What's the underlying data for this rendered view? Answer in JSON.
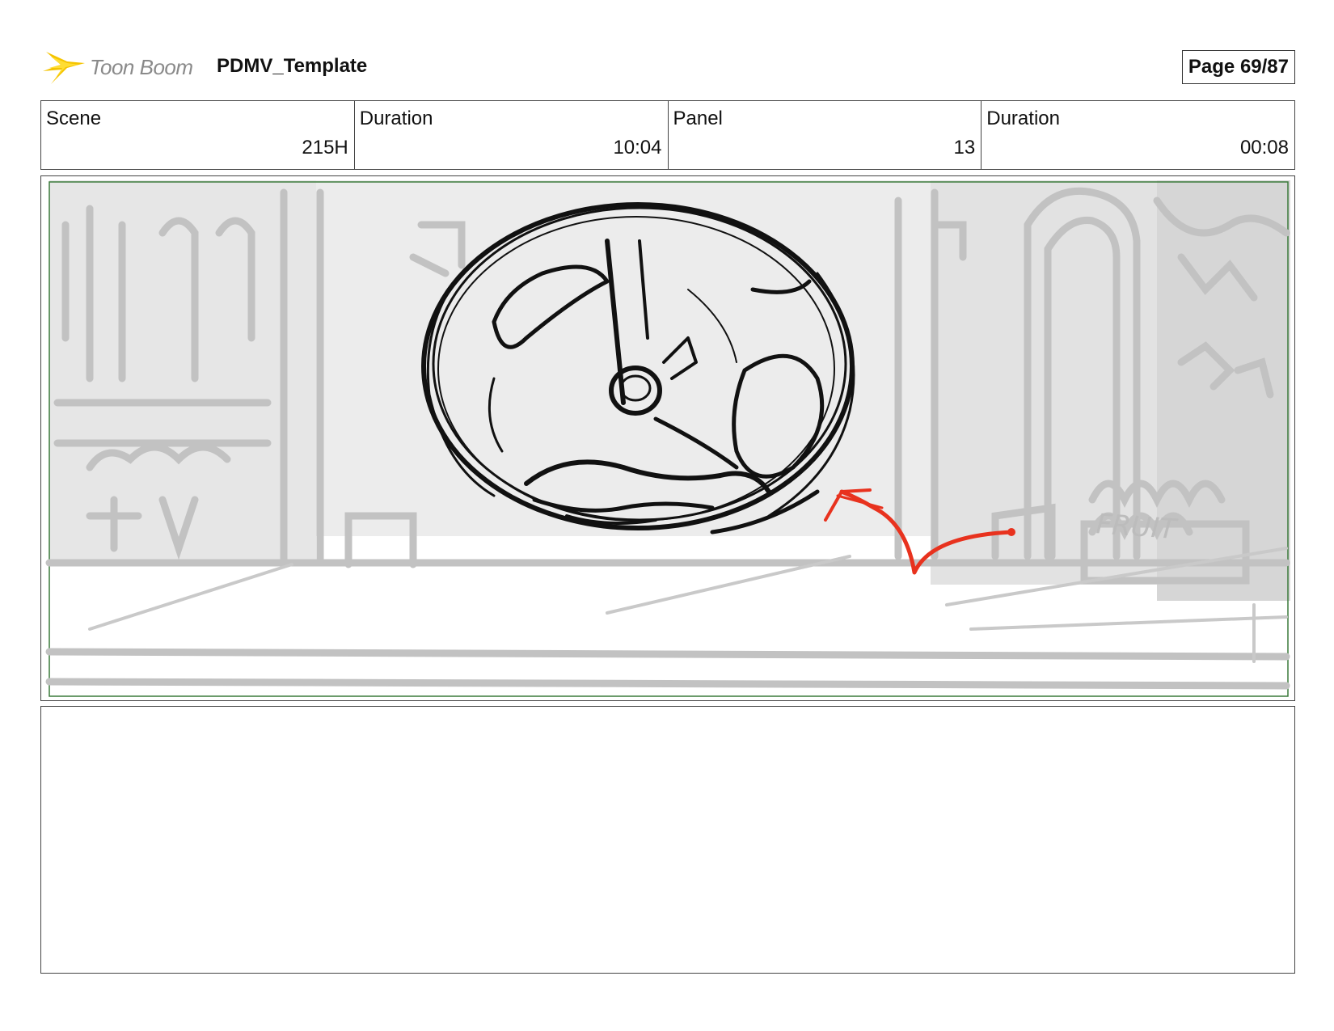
{
  "header": {
    "logo_text": "Toon Boom",
    "doc_title": "PDMV_Template",
    "page_label": "Page 69/87"
  },
  "info": {
    "scene_label": "Scene",
    "scene_value": "215H",
    "scene_duration_label": "Duration",
    "scene_duration_value": "10:04",
    "panel_label": "Panel",
    "panel_value": "13",
    "panel_duration_label": "Duration",
    "panel_duration_value": "00:08"
  },
  "sketch": {
    "sign_fruit": "FRUIT",
    "colors": {
      "safe_area": "#3a7a3a",
      "background_lines": "#c4c4c4",
      "ink": "#111111",
      "arrow": "#e8321e",
      "logo": "#f5c400"
    }
  },
  "notes": {
    "text": ""
  }
}
